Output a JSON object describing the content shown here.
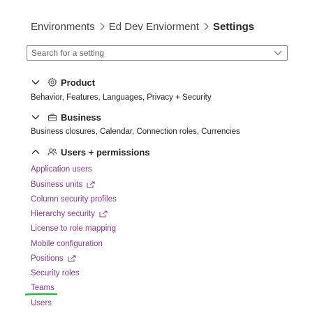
{
  "breadcrumb": {
    "items": [
      "Environments",
      "Ed Dev Enviorment"
    ],
    "current": "Settings"
  },
  "search": {
    "placeholder": "Search for a setting"
  },
  "sections": [
    {
      "title": "Product",
      "icon": "gear-icon",
      "state": "collapsed",
      "description": "Behavior, Features, Languages, Privacy + Security"
    },
    {
      "title": "Business",
      "icon": "briefcase-icon",
      "state": "collapsed",
      "description": "Business closures, Calendar, Connection roles, Currencies"
    },
    {
      "title": "Users + permissions",
      "icon": "people-icon",
      "state": "expanded",
      "links": [
        "Application users",
        "Business units",
        "Column security profiles",
        "Hierarchy security",
        "License to role mapping",
        "Mobile configuration",
        "Positions",
        "Security roles",
        "Teams",
        "Users"
      ]
    }
  ],
  "colors": {
    "link": "#8a3a93",
    "highlight": "#22c03a"
  }
}
